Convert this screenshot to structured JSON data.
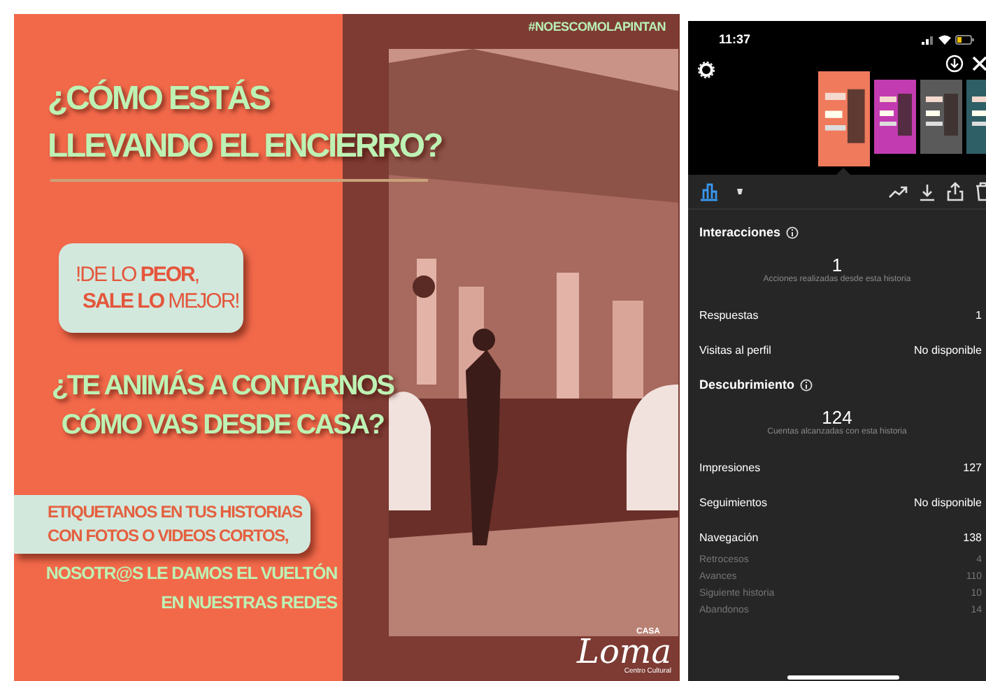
{
  "poster": {
    "hashtag": "#NOESCOMOLAPINTAN",
    "headline": [
      "¿CÓMO ESTÁS",
      "LLEVANDO EL ENCIERRO?"
    ],
    "callout": [
      "!DE LO **PEOR**,",
      "**SALE LO** MEJOR!"
    ],
    "question": [
      "¿TE ANIMÁS A CONTARNOS",
      "CÓMO VAS DESDE CASA?"
    ],
    "tag_box": [
      "ETIQUETANOS EN TUS HISTORIAS",
      "CON FOTOS O VIDEOS CORTOS,"
    ],
    "closing": [
      "NOSOTR@S LE DAMOS EL VUELTÓN",
      "EN NUESTRAS REDES"
    ],
    "logo": {
      "small": "CASA",
      "name": "Loma",
      "tagline": "Centro Cultural"
    }
  },
  "phone": {
    "status_bar": {
      "time": "11:37"
    },
    "story_thumbnails": [
      {
        "selected": true,
        "color": "#f07a5c"
      },
      {
        "selected": false,
        "color": "#c23bb0"
      },
      {
        "selected": false,
        "color": "#5a5a5a"
      },
      {
        "selected": false,
        "color": "#2f5f66"
      }
    ],
    "toolbar_tabs": [
      {
        "kind": "chart",
        "selected": true
      },
      {
        "kind": "dot",
        "selected": false
      }
    ],
    "sections": [
      {
        "title": "Interacciones",
        "value": "1",
        "caption": "Acciones realizadas desde esta historia",
        "rows": [
          {
            "kind": "main",
            "label": "Respuestas",
            "value": "1"
          },
          {
            "kind": "main",
            "label": "Visitas al perfil",
            "value": "No disponible"
          }
        ]
      },
      {
        "title": "Descubrimiento",
        "value": "124",
        "caption": "Cuentas alcanzadas con esta historia",
        "rows": [
          {
            "kind": "main",
            "label": "Impresiones",
            "value": "127"
          },
          {
            "kind": "main",
            "label": "Seguimientos",
            "value": "No disponible"
          },
          {
            "kind": "main",
            "label": "Navegación",
            "value": "138"
          },
          {
            "kind": "sub",
            "label": "Retrocesos",
            "value": "4"
          },
          {
            "kind": "sub",
            "label": "Avances",
            "value": "110"
          },
          {
            "kind": "sub",
            "label": "Siguiente historia",
            "value": "10"
          },
          {
            "kind": "sub",
            "label": "Abandonos",
            "value": "14"
          }
        ]
      }
    ]
  }
}
